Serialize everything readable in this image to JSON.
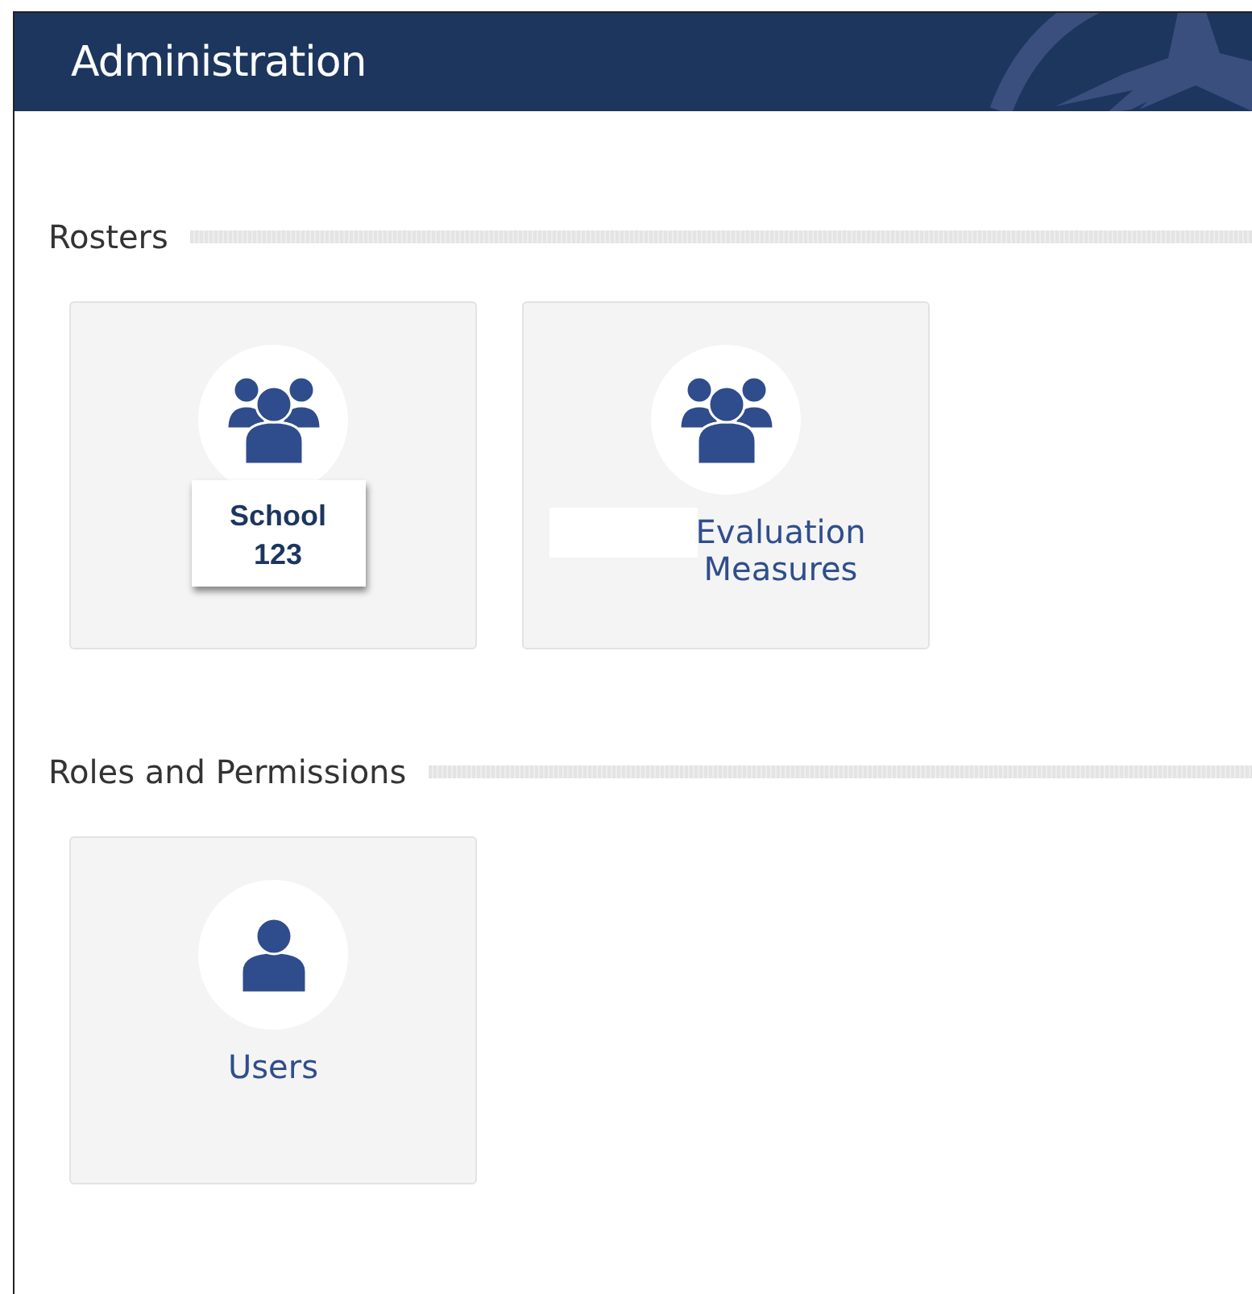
{
  "header": {
    "title": "Administration"
  },
  "sections": [
    {
      "heading": "Rosters",
      "tiles": [
        {
          "kind": "group",
          "label": "School\n123",
          "callout": true,
          "redacted": false
        },
        {
          "kind": "group",
          "label": "Evaluation\nMeasures",
          "callout": false,
          "redacted": true
        }
      ]
    },
    {
      "heading": "Roles and Permissions",
      "tiles": [
        {
          "kind": "user",
          "label": "Users",
          "callout": false,
          "redacted": false
        }
      ]
    }
  ]
}
